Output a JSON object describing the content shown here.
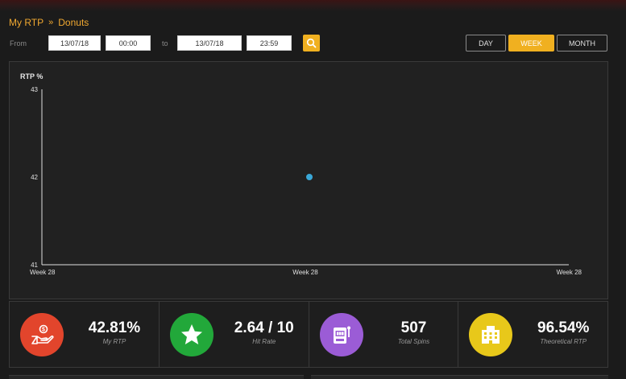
{
  "breadcrumb": {
    "root": "My RTP",
    "separator": "»",
    "current": "Donuts"
  },
  "filters": {
    "from_label": "From",
    "from_date": "13/07/18",
    "from_time": "00:00",
    "to_label": "to",
    "to_date": "13/07/18",
    "to_time": "23:59",
    "search_icon": "search-icon"
  },
  "periods": [
    {
      "label": "DAY",
      "active": false
    },
    {
      "label": "WEEK",
      "active": true
    },
    {
      "label": "MONTH",
      "active": false
    }
  ],
  "chart_data": {
    "type": "scatter",
    "ylabel": "RTP %",
    "ylim": [
      41,
      43
    ],
    "y_ticks": [
      "43",
      "42",
      "41"
    ],
    "x_ticks": [
      "Week 28",
      "Week 28",
      "Week 28"
    ],
    "points": [
      {
        "x": "Week 28",
        "y": 42
      }
    ],
    "point_color": "#3aa8d8",
    "grid": false
  },
  "stats": [
    {
      "value": "42.81%",
      "label": "My RTP",
      "icon": "hand-coin-icon",
      "color": "#e2452c"
    },
    {
      "value": "2.64 / 10",
      "label": "Hit Rate",
      "icon": "star-icon",
      "color": "#22a83a"
    },
    {
      "value": "507",
      "label": "Total Spins",
      "icon": "slot-machine-icon",
      "color": "#9b5cd6"
    },
    {
      "value": "96.54%",
      "label": "Theoretical RTP",
      "icon": "building-icon",
      "color": "#e8c81a"
    }
  ],
  "colors": {
    "accent": "#f0b020",
    "background": "#1b1b1b"
  }
}
